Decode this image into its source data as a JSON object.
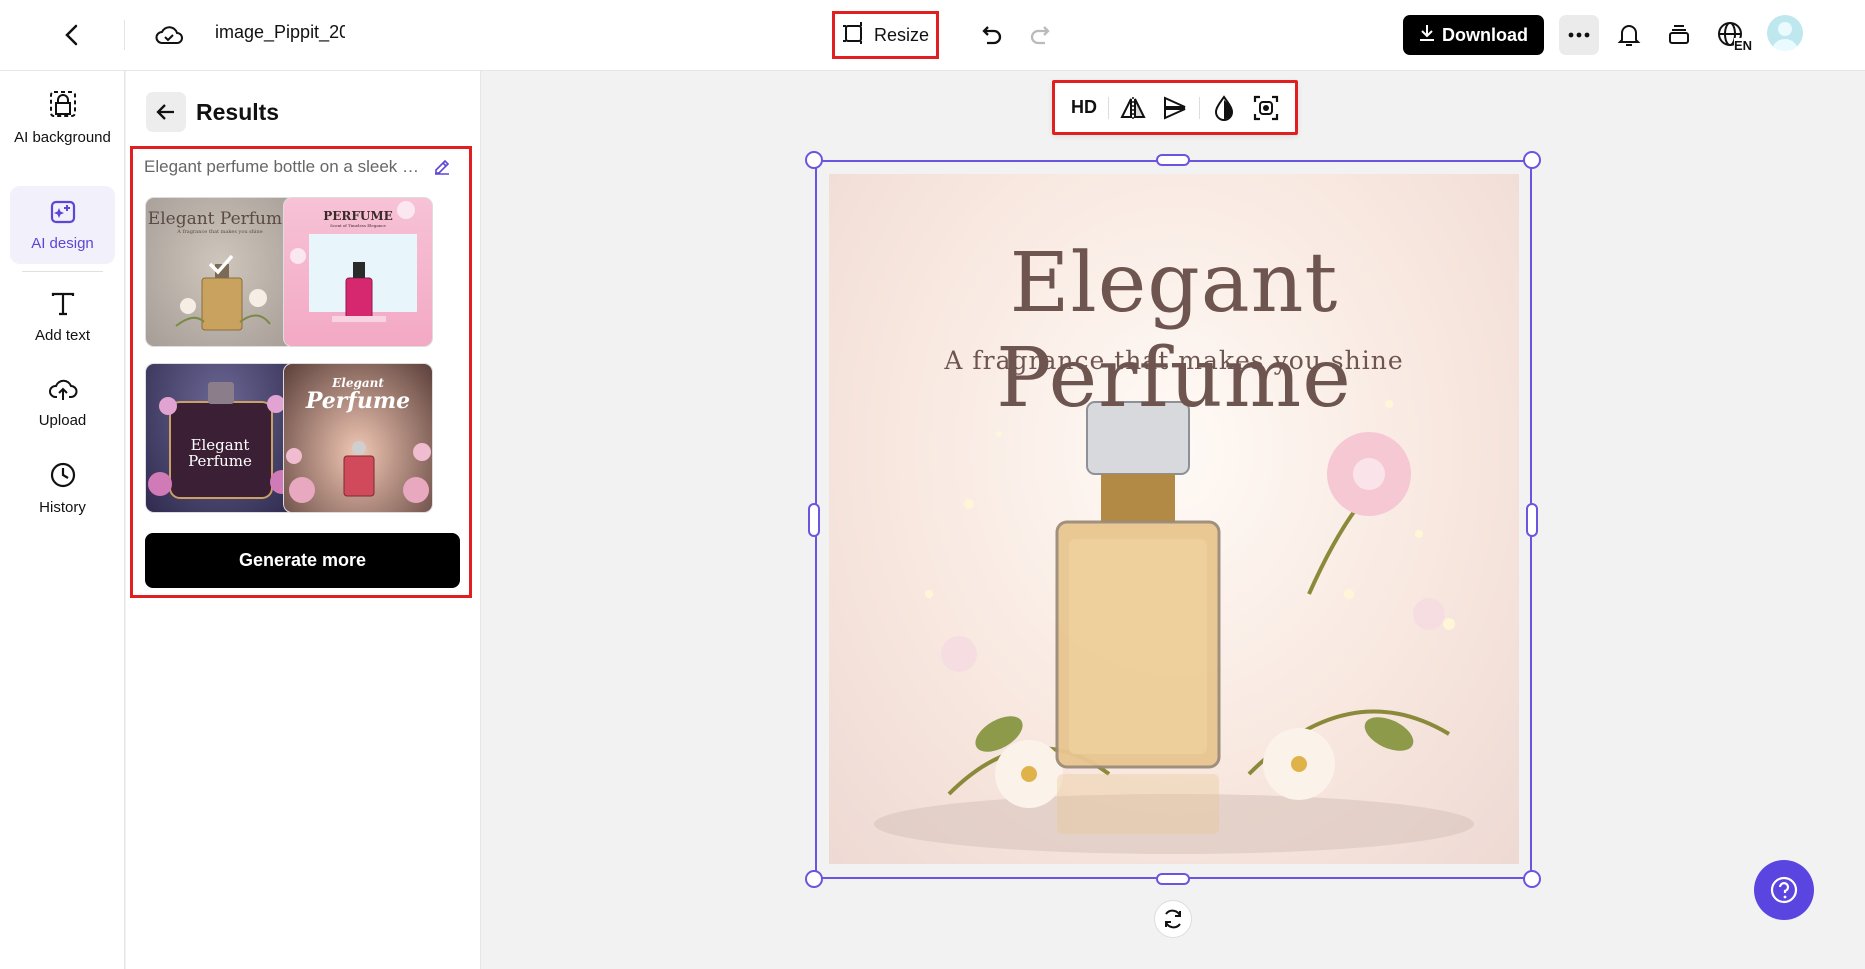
{
  "header": {
    "doc_title": "image_Pippit_20",
    "resize_label": "Resize",
    "download_label": "Download",
    "language_code": "EN"
  },
  "rail": {
    "items": [
      {
        "label": "AI background",
        "icon": "ai-background-icon"
      },
      {
        "label": "AI design",
        "icon": "ai-design-icon"
      },
      {
        "label": "Add text",
        "icon": "text-icon"
      },
      {
        "label": "Upload",
        "icon": "upload-icon"
      },
      {
        "label": "History",
        "icon": "history-icon"
      }
    ]
  },
  "panel": {
    "title": "Results",
    "prompt": "Elegant perfume bottle on a sleek background",
    "results": [
      {
        "title": "Elegant Perfume",
        "subtitle": "A fragrance that makes you shine",
        "selected": true
      },
      {
        "title": "PERFUME",
        "subtitle": "Scent of Timeless Elegance"
      },
      {
        "title": "Elegant",
        "title2": "Perfume"
      },
      {
        "title": "Elegant",
        "title2": "Perfume"
      }
    ],
    "generate_more_label": "Generate more"
  },
  "toolbar": {
    "hd_label": "HD",
    "tools": [
      "flip-horizontal-icon",
      "flip-vertical-icon",
      "opacity-icon",
      "cutout-icon"
    ]
  },
  "canvas": {
    "title": "Elegant Perfume",
    "subtitle": "A fragrance that makes you shine"
  },
  "colors": {
    "accent": "#5b45e0",
    "highlight": "#e02020",
    "selection": "#6a55e0"
  }
}
